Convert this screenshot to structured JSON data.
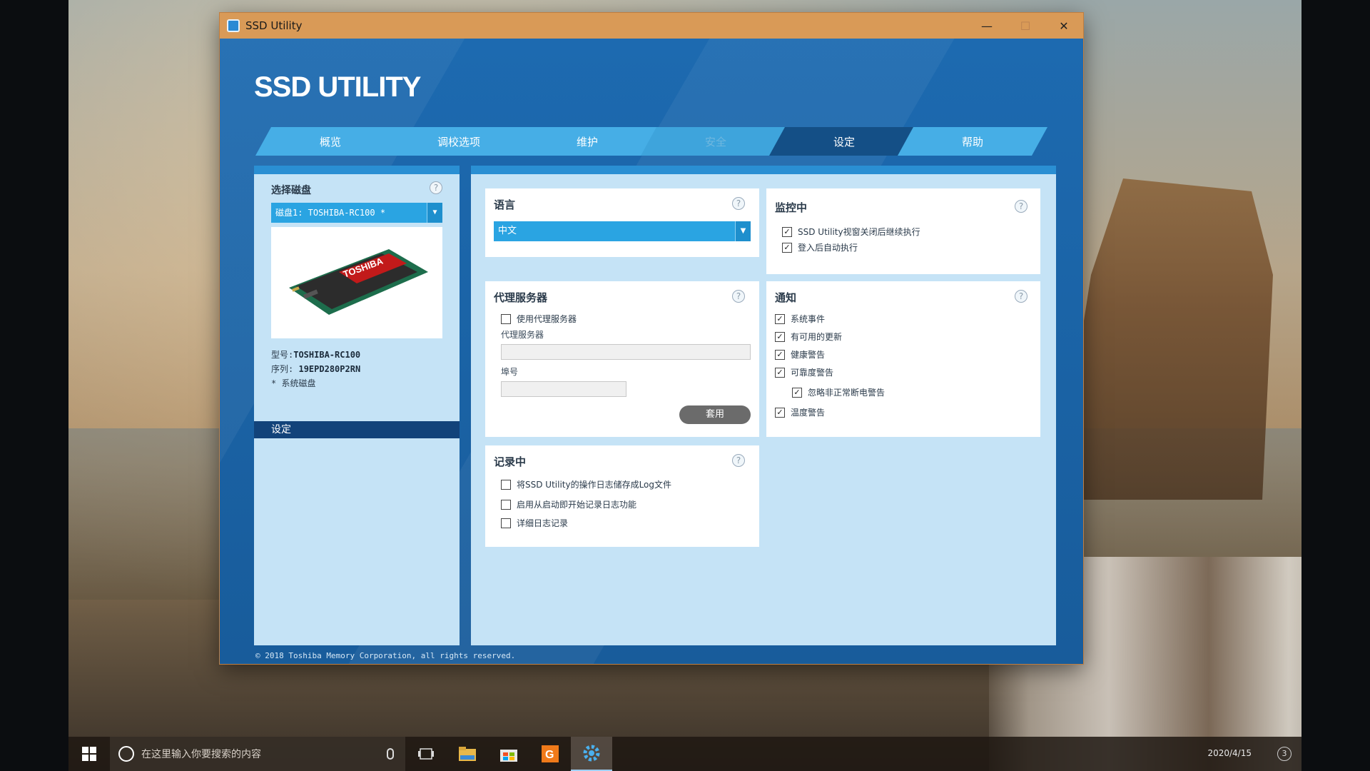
{
  "window": {
    "title": "SSD Utility"
  },
  "app": {
    "logo": "SSD UTILITY",
    "footer": "© 2018 Toshiba Memory Corporation, all rights reserved."
  },
  "tabs": [
    {
      "label": "概览",
      "state": "normal"
    },
    {
      "label": "调校选项",
      "state": "normal"
    },
    {
      "label": "维护",
      "state": "normal"
    },
    {
      "label": "安全",
      "state": "disabled"
    },
    {
      "label": "设定",
      "state": "active"
    },
    {
      "label": "帮助",
      "state": "normal"
    }
  ],
  "sidebar": {
    "select_disk_label": "选择磁盘",
    "disk_selected": "磁盘1: TOSHIBA-RC100 *",
    "image_brand": "TOSHIBA",
    "model_label": "型号:",
    "model_value": "TOSHIBA-RC100",
    "serial_label": "序列:",
    "serial_value": "19EPD280P2RN",
    "system_disk_note": "* 系统磁盘",
    "nav_item": "设定"
  },
  "language": {
    "title": "语言",
    "selected": "中文"
  },
  "proxy": {
    "title": "代理服务器",
    "use_proxy_label": "使用代理服务器",
    "use_proxy_checked": false,
    "server_label": "代理服务器",
    "server_value": "",
    "port_label": "埠号",
    "port_value": "",
    "apply_label": "套用"
  },
  "logging": {
    "title": "记录中",
    "items": [
      {
        "label": "将SSD Utility的操作日志储存成Log文件",
        "checked": false
      },
      {
        "label": "启用从启动即开始记录日志功能",
        "checked": false
      },
      {
        "label": "详细日志记录",
        "checked": false
      }
    ]
  },
  "monitoring": {
    "title": "监控中",
    "items": [
      {
        "label": "SSD Utility视窗关闭后继续执行",
        "checked": true
      },
      {
        "label": "登入后自动执行",
        "checked": true
      }
    ]
  },
  "notifications": {
    "title": "通知",
    "items": [
      {
        "label": "系统事件",
        "checked": true
      },
      {
        "label": "有可用的更新",
        "checked": true
      },
      {
        "label": "健康警告",
        "checked": true
      },
      {
        "label": "可靠度警告",
        "checked": true
      },
      {
        "label": "忽略非正常断电警告",
        "checked": true
      },
      {
        "label": "温度警告",
        "checked": true
      }
    ]
  },
  "taskbar": {
    "search_placeholder": "在这里输入你要搜索的内容",
    "date": "2020/4/15",
    "badge": "3"
  },
  "colors": {
    "accent": "#2aa4e2",
    "active_tab": "#144f86",
    "window_bg": "#1a5f9f",
    "titlebar": "#d99a57"
  }
}
